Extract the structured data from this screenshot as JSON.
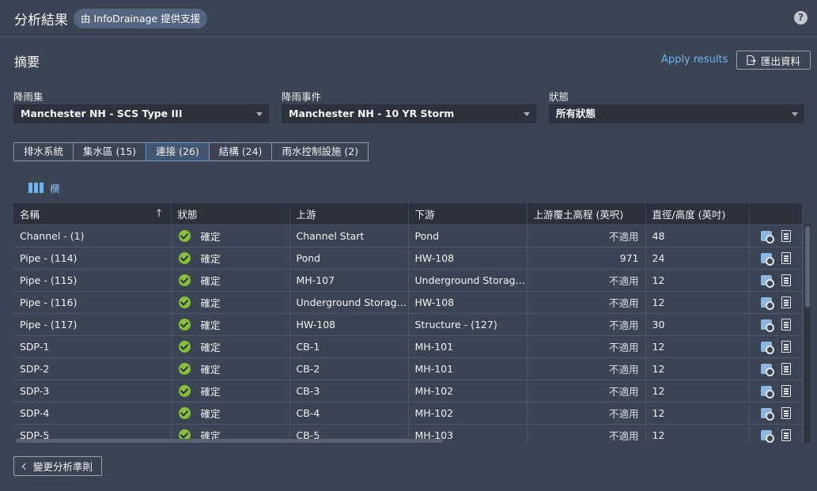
{
  "header": {
    "title": "分析結果",
    "badge": "由 InfoDrainage 提供支援"
  },
  "summary": {
    "title": "摘要",
    "apply_results": "Apply results",
    "export_label": "匯出資料"
  },
  "filters": {
    "rainfall_set": {
      "label": "降雨集",
      "value": "Manchester NH - SCS Type III"
    },
    "rainfall_event": {
      "label": "降雨事件",
      "value": "Manchester NH - 10 YR Storm"
    },
    "status": {
      "label": "狀態",
      "value": "所有狀態"
    }
  },
  "tabs": [
    {
      "label": "排水系統"
    },
    {
      "label": "集水區 (15)"
    },
    {
      "label": "連接 (26)"
    },
    {
      "label": "結構 (24)"
    },
    {
      "label": "雨水控制設施 (2)"
    }
  ],
  "active_tab": "連接 (26)",
  "columns_button": "欄",
  "table": {
    "headers": {
      "name": "名稱",
      "status": "狀態",
      "upstream": "上游",
      "downstream": "下游",
      "cover": "上游覆土高程 (英呎)",
      "diameter": "直徑/高度 (英吋)"
    },
    "rows": [
      {
        "name": "Channel - (1)",
        "status": "確定",
        "upstream": "Channel Start",
        "downstream": "Pond",
        "cover": "不適用",
        "diameter": "48"
      },
      {
        "name": "Pipe - (114)",
        "status": "確定",
        "upstream": "Pond",
        "downstream": "HW-108",
        "cover": "971",
        "diameter": "24"
      },
      {
        "name": "Pipe - (115)",
        "status": "確定",
        "upstream": "MH-107",
        "downstream": "Underground Storage ...",
        "cover": "不適用",
        "diameter": "12"
      },
      {
        "name": "Pipe - (116)",
        "status": "確定",
        "upstream": "Underground Storage ...",
        "downstream": "HW-108",
        "cover": "不適用",
        "diameter": "12"
      },
      {
        "name": "Pipe - (117)",
        "status": "確定",
        "upstream": "HW-108",
        "downstream": "Structure - (127)",
        "cover": "不適用",
        "diameter": "30"
      },
      {
        "name": "SDP-1",
        "status": "確定",
        "upstream": "CB-1",
        "downstream": "MH-101",
        "cover": "不適用",
        "diameter": "12"
      },
      {
        "name": "SDP-2",
        "status": "確定",
        "upstream": "CB-2",
        "downstream": "MH-101",
        "cover": "不適用",
        "diameter": "12"
      },
      {
        "name": "SDP-3",
        "status": "確定",
        "upstream": "CB-3",
        "downstream": "MH-102",
        "cover": "不適用",
        "diameter": "12"
      },
      {
        "name": "SDP-4",
        "status": "確定",
        "upstream": "CB-4",
        "downstream": "MH-102",
        "cover": "不適用",
        "diameter": "12"
      },
      {
        "name": "SDP-5",
        "status": "確定",
        "upstream": "CB-5",
        "downstream": "MH-103",
        "cover": "不適用",
        "diameter": "12"
      }
    ]
  },
  "footer": {
    "back_label": "變更分析準則"
  },
  "colors": {
    "background": "#3b4453",
    "accent": "#6fb4ec",
    "ok": "#87bf3c"
  }
}
